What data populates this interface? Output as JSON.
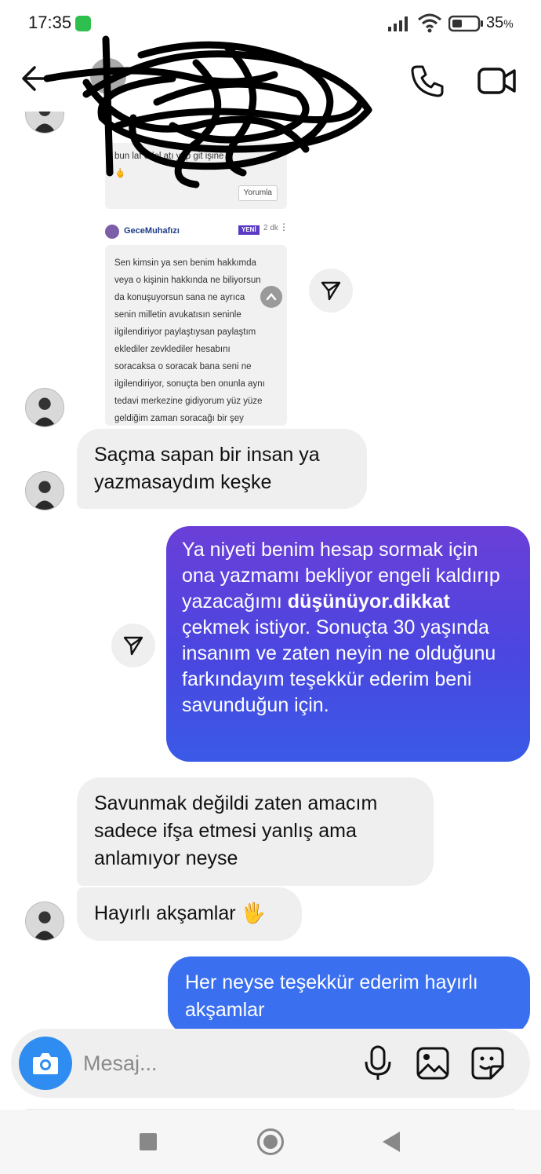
{
  "status_bar": {
    "time": "17:35",
    "battery_percent": "35",
    "battery_unit": "%",
    "notification_icon": "whatsapp-icon",
    "icons": [
      "signal-icon",
      "wifi-icon",
      "battery-icon"
    ]
  },
  "header": {
    "contact_name": "",
    "icons": [
      "back-arrow-icon",
      "phone-icon",
      "video-camera-icon"
    ]
  },
  "shared_post": {
    "top_text": "bun   laf edel   atı yap   git işine",
    "top_emoji": "🖕",
    "reply_label": "Yorumla",
    "comment_user": "GeceMuhafızı",
    "new_badge": "YENİ",
    "comment_time": "2 dk",
    "comment_more": "⋮",
    "comment_lines": [
      "Sen kimsin ya sen benim hakkımda",
      "veya o kişinin hakkında ne biliyorsun",
      "da konuşuyorsun sana ne ayrıca",
      "senin milletin avukatısın seninle",
      "ilgilendiriyor paylaştıysan paylaştım",
      "eklediler zevklediler hesabını",
      "soracaksa o soracak bana seni ne",
      "ilgilendiriyor, sonuçta ben onunla aynı",
      "tedavi merkezine gidiyorum yüz yüze",
      "geldiğim zaman soracağı bir şey"
    ]
  },
  "messages": {
    "m1": "Saçma sapan bir insan ya yazmasaydım keşke",
    "m2_part1": "Ya niyeti benim hesap sormak için ona yazmamı bekliyor engeli kaldırıp yazacağımı",
    "m2_bold": "düşünüyor.dikkat",
    "m2_part2": "çekmek istiyor. Sonuçta 30 yaşında insanım ve zaten neyin ne olduğunu farkındayım teşekkür ederim beni savunduğun için.",
    "m3": "Savunmak değildi zaten amacım sadece ifşa etmesi yanlış ama anlamıyor neyse",
    "m4": "Hayırlı akşamlar 🖐️",
    "m5": "Her neyse teşekkür ederim hayırlı akşamlar"
  },
  "composer": {
    "placeholder": "Mesaj...",
    "icons": [
      "camera-icon",
      "microphone-icon",
      "gallery-icon",
      "sticker-icon"
    ]
  },
  "colors": {
    "outgoing_gradient_top": "#6a3fd8",
    "outgoing_gradient_bottom": "#3a5ae6",
    "outgoing_solid": "#3a6ff0",
    "incoming": "#efefef",
    "camera_button": "#2f8cf0"
  }
}
